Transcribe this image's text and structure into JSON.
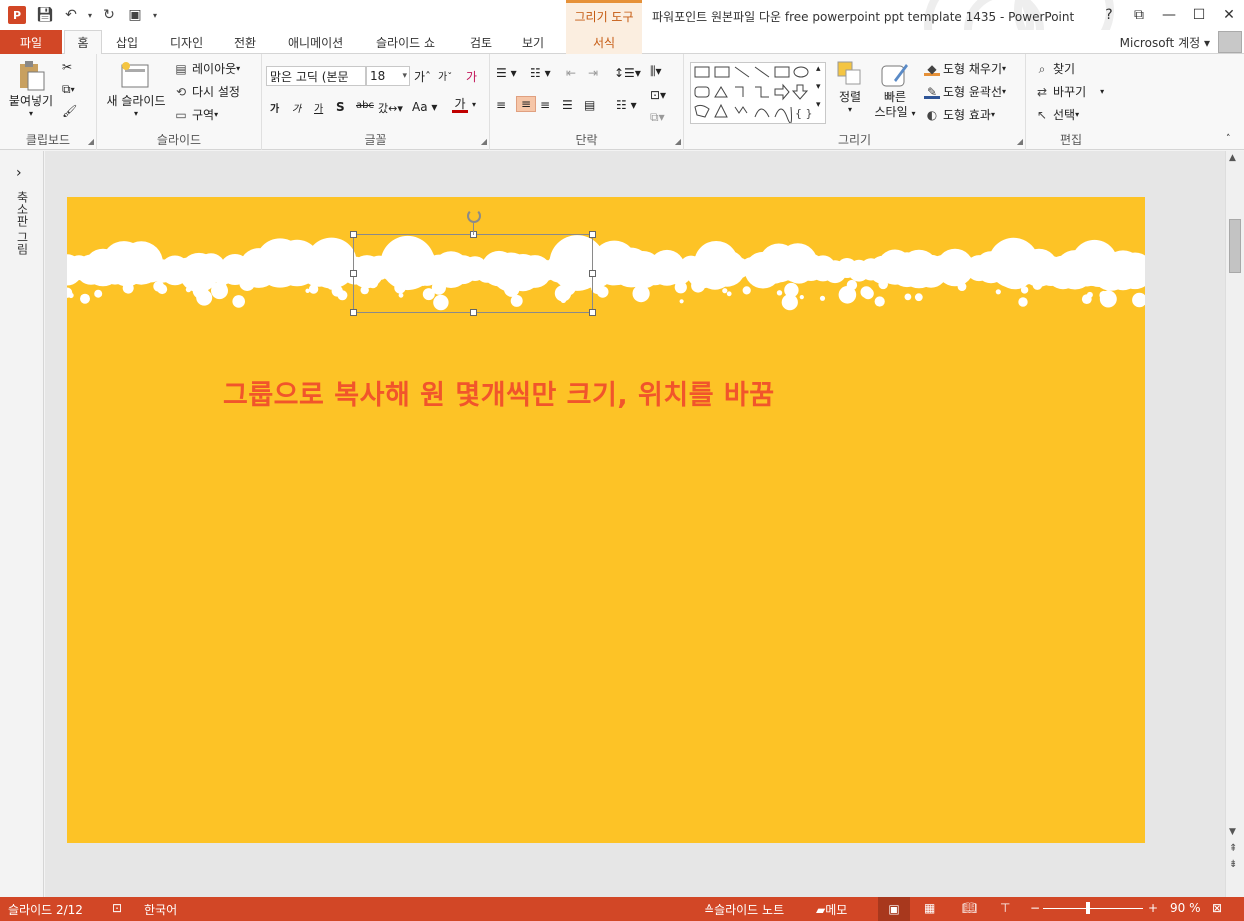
{
  "app": {
    "title": "파워포인트 원본파일 다운 free powerpoint ppt template 1435 - PowerPoint",
    "logo": "P",
    "context_tab": "그리기 도구",
    "account": "Microsoft 계정"
  },
  "qat": [
    "save-icon",
    "undo-icon",
    "redo-icon",
    "present-icon"
  ],
  "tabs": [
    "파일",
    "홈",
    "삽입",
    "디자인",
    "전환",
    "애니메이션",
    "슬라이드 쇼",
    "검토",
    "보기",
    "서식"
  ],
  "window_controls": [
    "?",
    "⧉",
    "—",
    "☐",
    "✕"
  ],
  "ribbon": {
    "clipboard": {
      "label": "클립보드",
      "paste": "붙여넣기"
    },
    "slides": {
      "label": "슬라이드",
      "new_slide": "새 슬라이드",
      "layout": "레이아웃",
      "reset": "다시 설정",
      "section": "구역"
    },
    "font": {
      "label": "글꼴",
      "font_name": "맑은 고딕 (본문",
      "font_size": "18"
    },
    "paragraph": {
      "label": "단락"
    },
    "drawing": {
      "label": "그리기",
      "arrange": "정렬",
      "quick_styles_1": "빠른",
      "quick_styles_2": "스타일",
      "fill": "도형 채우기",
      "outline": "도형 윤곽선",
      "effects": "도형 효과"
    },
    "editing": {
      "label": "편집",
      "find": "찾기",
      "replace": "바꾸기",
      "select": "선택"
    }
  },
  "left_pane": {
    "title": "축소판 그림",
    "toggle": "›"
  },
  "slide": {
    "text": "그룹으로 복사해 원 몇개씩만 크기, 위치를 바꿈",
    "bg": "#fdc326",
    "text_color": "#f1552b"
  },
  "status": {
    "slide_num": "슬라이드 2/12",
    "language": "한국어",
    "notes": "슬라이드 노트",
    "comments": "메모",
    "zoom": "90 %",
    "zoom_value": 90
  }
}
